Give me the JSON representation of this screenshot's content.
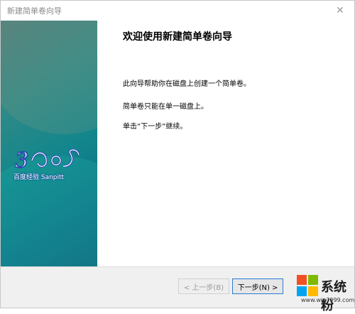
{
  "window": {
    "title": "新建简单卷向导"
  },
  "banner": {
    "watermark_text": "百度经验 Sanpitt"
  },
  "content": {
    "heading": "欢迎使用新建简单卷向导",
    "paragraphs": [
      "此向导帮助你在磁盘上创建一个简单卷。",
      "简单卷只能在单一磁盘上。",
      "单击“下一步”继续。"
    ]
  },
  "footer": {
    "back_label": "< 上一步(B)",
    "next_label": "下一步(N) >"
  },
  "site_watermark": {
    "brand": "系统粉",
    "url": "www.win7999.com",
    "colors": {
      "red": "#f25022",
      "green": "#7fba00",
      "blue": "#00a4ef",
      "yellow": "#ffb900"
    }
  },
  "icons": {
    "close": "close-icon",
    "logo": "windows-logo-icon"
  }
}
